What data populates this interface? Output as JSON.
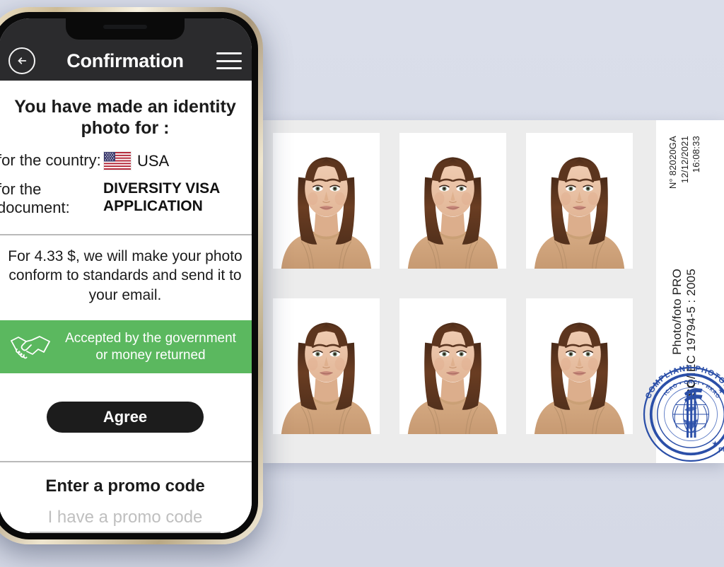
{
  "background": {
    "color": "#d9dde8"
  },
  "phone": {
    "frame_color": "#cdbb95",
    "header": {
      "title": "Confirmation",
      "back_icon": "back-arrow-icon",
      "menu_icon": "hamburger-menu-icon",
      "bg_color": "#2b2b2d"
    },
    "content": {
      "headline": "You have made an identity photo for :",
      "rows": [
        {
          "label": "for the country:",
          "value": "USA",
          "flag": "usa-flag",
          "bold": false
        },
        {
          "label": "for the document:",
          "value": "DIVERSITY VISA APPLICATION",
          "bold": true
        }
      ],
      "pitch": "For 4.33 $, we will make your photo conform to standards and send it to your email.",
      "price": "4.33 $",
      "guarantee": {
        "icon": "handshake-icon",
        "text": "Accepted by the government or money returned",
        "color": "#5bb85f"
      },
      "agree_label": "Agree",
      "promo": {
        "title": "Enter a promo code",
        "placeholder": "I have a promo code",
        "value": ""
      }
    }
  },
  "photo_sheet": {
    "background": "#ececec",
    "photo_count": 6,
    "rows": 2,
    "columns": 3,
    "photo_alt": "identity-photo-portrait",
    "serial": "N° 82020GA",
    "date": "12/12/2021",
    "time": "16:08:33",
    "brand": "Photo/foto PRO",
    "standard_prefix": "ISO",
    "standard": "/IEC 19794-5 : 2005",
    "stamp": {
      "outer_text": "COMPLIANT PHOTOS",
      "inner_text": "ICAO • OACI • ИКАО",
      "footer_text": "FOR",
      "star": "★",
      "color": "#2b4fa8"
    }
  }
}
